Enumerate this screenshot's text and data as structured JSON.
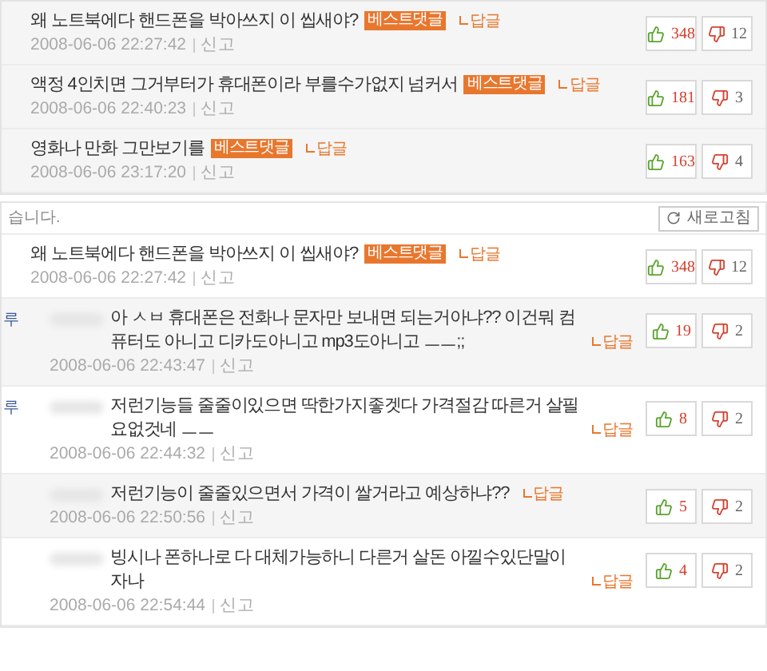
{
  "best_comments": [
    {
      "text": "왜 노트북에다 핸드폰을 박아쓰지 이 씹새야?",
      "badge": "베스트댓글",
      "reply": "답글",
      "date": "2008-06-06 22:27:42",
      "report": "신고",
      "likes": "348",
      "dislikes": "12"
    },
    {
      "text": "액정 4인치면 그거부터가 휴대폰이라 부를수가없지 넘커서",
      "badge": "베스트댓글",
      "reply": "답글",
      "date": "2008-06-06 22:40:23",
      "report": "신고",
      "likes": "181",
      "dislikes": "3"
    },
    {
      "text": "영화나 만화 그만보기를",
      "badge": "베스트댓글",
      "reply": "답글",
      "date": "2008-06-06 23:17:20",
      "report": "신고",
      "likes": "163",
      "dislikes": "4"
    }
  ],
  "notice": "습니다.",
  "refresh_button": "새로고침",
  "comments": [
    {
      "kind": "comment",
      "text": "왜 노트북에다 핸드폰을 박아쓰지 이 씹새야?",
      "badge": "베스트댓글",
      "reply": "답글",
      "date": "2008-06-06 22:27:42",
      "report": "신고",
      "likes": "348",
      "dislikes": "12"
    },
    {
      "kind": "reply",
      "marker": "루",
      "text": "아 ㅅㅂ 휴대폰은 전화나 문자만 보내면 되는거아냐?? 이건뭐 컴퓨터도 아니고 디카도아니고 mp3도아니고 ㅡㅡ;;",
      "reply": "답글",
      "date": "2008-06-06 22:43:47",
      "report": "신고",
      "likes": "19",
      "dislikes": "2"
    },
    {
      "kind": "reply",
      "marker": "루",
      "text": "저런기능들 줄줄이있으면 딱한가지좋겟다 가격절감 따른거 살필요없것네 ㅡㅡ",
      "reply": "답글",
      "date": "2008-06-06 22:44:32",
      "report": "신고",
      "likes": "8",
      "dislikes": "2"
    },
    {
      "kind": "reply",
      "text": "저런기능이 줄줄있으면서 가격이 쌀거라고 예상하냐??",
      "reply": "답글",
      "date": "2008-06-06 22:50:56",
      "report": "신고",
      "likes": "5",
      "dislikes": "2"
    },
    {
      "kind": "reply",
      "text": "빙시나 폰하나로 다 대체가능하니 다른거 살돈 아낄수있단말이자나",
      "reply": "답글",
      "date": "2008-06-06 22:54:44",
      "report": "신고",
      "likes": "4",
      "dislikes": "2"
    }
  ]
}
